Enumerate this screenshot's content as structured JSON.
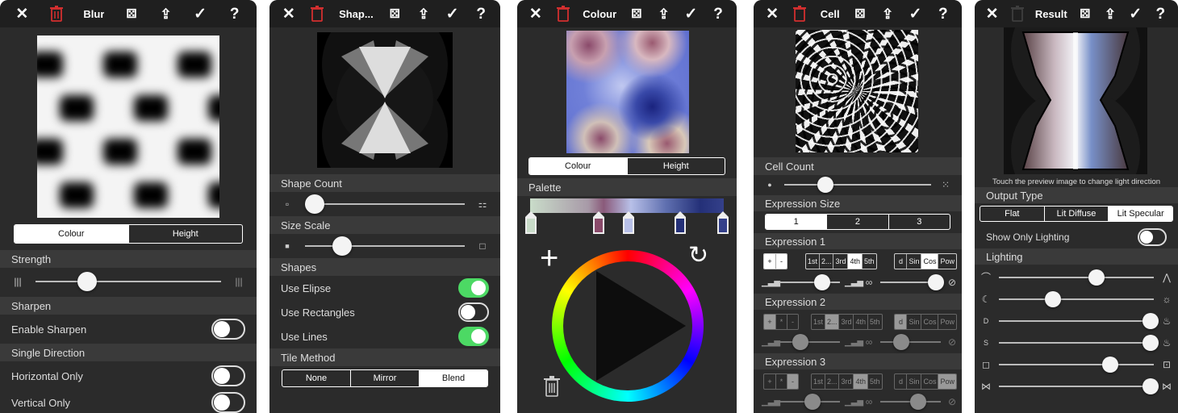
{
  "icons": {
    "close": "✕",
    "trash": "🗑",
    "dice": "⚄",
    "share": "⇪",
    "check": "✓",
    "help": "?"
  },
  "panels": {
    "blur": {
      "title": "Blur",
      "seg": [
        "Colour",
        "Height"
      ],
      "strength_label": "Strength",
      "sharpen_label": "Sharpen",
      "enable_sharpen": "Enable Sharpen",
      "single_direction": "Single Direction",
      "horizontal_only": "Horizontal Only",
      "vertical_only": "Vertical Only",
      "strength_value": 0.28
    },
    "shapes": {
      "title": "Shap...",
      "shape_count": "Shape Count",
      "size_scale": "Size Scale",
      "shapes": "Shapes",
      "use_elipse": "Use Elipse",
      "use_rectangles": "Use Rectangles",
      "use_lines": "Use Lines",
      "tile_method": "Tile Method",
      "tile_options": [
        "None",
        "Mirror",
        "Blend"
      ],
      "shape_count_value": 0.06,
      "size_scale_value": 0.23
    },
    "colour": {
      "title": "Colour",
      "seg": [
        "Colour",
        "Height"
      ],
      "palette": "Palette",
      "plus": "+",
      "reset": "↻",
      "stop_colors": [
        "#c9dcc9",
        "#8a4a6a",
        "#b8c0e8",
        "#243078",
        "#34408a"
      ]
    },
    "cell": {
      "title": "Cell",
      "cell_count": "Cell Count",
      "expression_size": "Expression Size",
      "size_options": [
        "1",
        "2",
        "3"
      ],
      "exp1": "Expression 1",
      "exp2": "Expression 2",
      "exp3": "Expression 3",
      "ops": [
        "+",
        "*",
        "-"
      ],
      "orders": [
        "1st",
        "2...",
        "3rd",
        "4th",
        "5th"
      ],
      "funcs": [
        "d",
        "Sin",
        "Cos",
        "Pow"
      ],
      "cell_count_value": 0.28
    },
    "result": {
      "title": "Result",
      "hint": "Touch the preview image to change light direction",
      "output_type": "Output Type",
      "output_options": [
        "Flat",
        "Lit Diffuse",
        "Lit Specular"
      ],
      "show_only_lighting": "Show Only Lighting",
      "lighting": "Lighting",
      "lighting_values": [
        0.63,
        0.35,
        0.98,
        0.98,
        0.72,
        0.98
      ]
    }
  }
}
